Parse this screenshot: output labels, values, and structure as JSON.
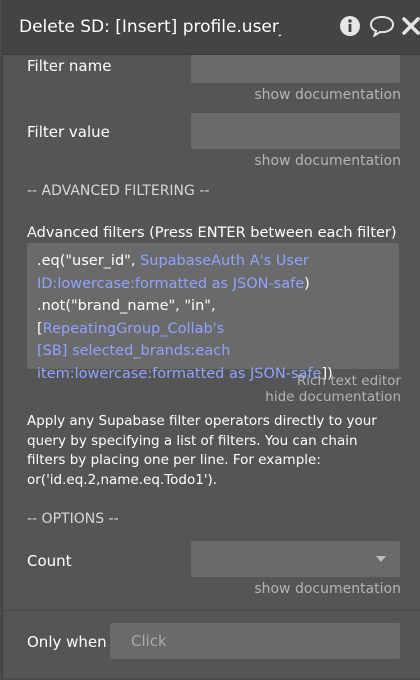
{
  "header": {
    "title": "Delete SD: [Insert] profile.user_c",
    "icons": [
      "info-icon",
      "comment-icon",
      "close-icon"
    ]
  },
  "fields": {
    "filter_name_label": "Filter name",
    "filter_name_value": "",
    "filter_name_doc": "show documentation",
    "filter_value_label": "Filter value",
    "filter_value_value": "",
    "filter_value_doc": "show documentation"
  },
  "advanced": {
    "section_title": "-- ADVANCED FILTERING --",
    "label": "Advanced filters (Press ENTER between each filter)",
    "line1_prefix": ".eq(\"user_id\", ",
    "line1_dynamic_a": "SupabaseAuth A's User",
    "line2_dynamic": "ID:lowercase:formatted as JSON-safe",
    "line2_suffix": ")",
    "line3_prefix": ".not(\"brand_name\", \"in\", [",
    "line3_dynamic": "RepeatingGroup_Collab's",
    "line4_dynamic": "[SB] selected_brands:each",
    "line5_dynamic": "item:lowercase:formatted as JSON-safe",
    "line5_suffix": "])",
    "rich_text_link": "Rich text editor",
    "hide_doc_link": "hide documentation",
    "description": "Apply any Supabase filter operators directly to your query by specifying a list of filters. You can chain filters by placing one per line. For example: or('id.eq.2,name.eq.Todo1')."
  },
  "options": {
    "section_title": "-- OPTIONS --",
    "count_label": "Count",
    "count_value": "",
    "count_doc": "show documentation"
  },
  "footer": {
    "only_when_label": "Only when",
    "only_when_placeholder": "Click"
  },
  "colors": {
    "panel_bg": "#555555",
    "field_bg": "#6a6a6a",
    "dynamic_text": "#8fa4ff",
    "link_text": "#b5b5b5"
  }
}
